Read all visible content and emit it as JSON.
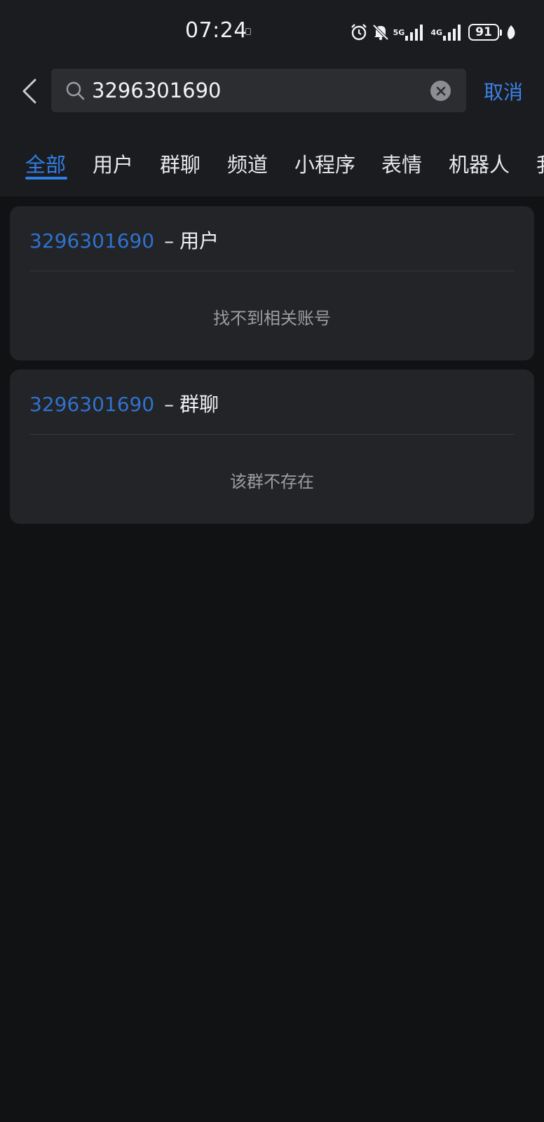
{
  "status_bar": {
    "time": "07:24",
    "network_1": "5G",
    "network_2": "4G",
    "battery": "91"
  },
  "search": {
    "query": "3296301690",
    "cancel_label": "取消"
  },
  "tabs": [
    {
      "label": "全部",
      "active": true
    },
    {
      "label": "用户"
    },
    {
      "label": "群聊"
    },
    {
      "label": "频道"
    },
    {
      "label": "小程序"
    },
    {
      "label": "表情"
    },
    {
      "label": "机器人"
    },
    {
      "label": "我"
    }
  ],
  "results": [
    {
      "keyword": "3296301690",
      "separator": "–",
      "category": "用户",
      "empty_text": "找不到相关账号"
    },
    {
      "keyword": "3296301690",
      "separator": "–",
      "category": "群聊",
      "empty_text": "该群不存在"
    }
  ],
  "colors": {
    "accent": "#2f7ee6",
    "keyword": "#2f72cf",
    "background": "#111214",
    "header_background": "#1b1c1f",
    "card_background": "#232427"
  }
}
